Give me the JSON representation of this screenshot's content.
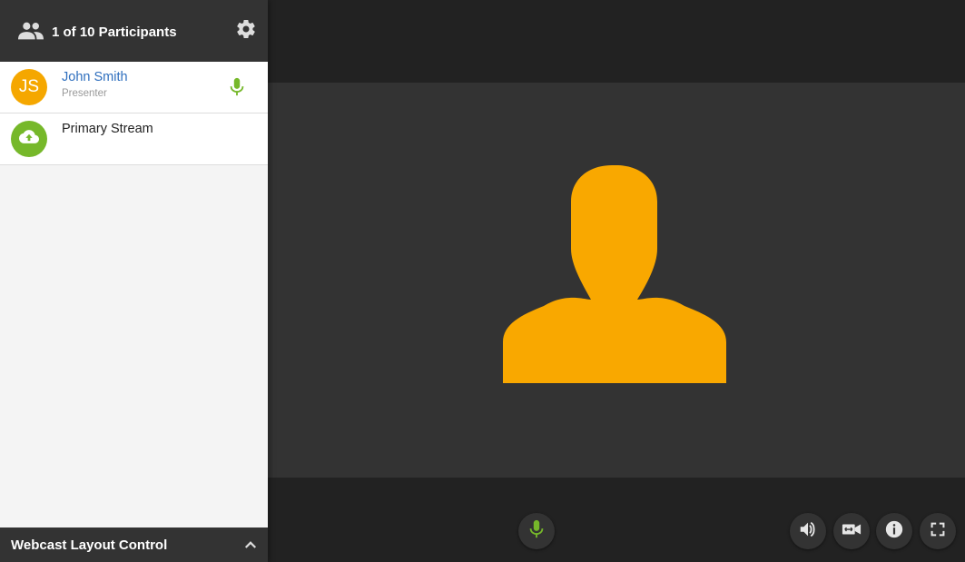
{
  "sidebar": {
    "header": {
      "icon": "people-icon",
      "title": "1 of 10 Participants",
      "settings_icon": "gear-icon"
    },
    "participants": [
      {
        "initials": "JS",
        "name": "John Smith",
        "role": "Presenter",
        "avatar_color": "#f5a700",
        "mic_icon": "microphone-icon",
        "mic_color": "#76b82a"
      },
      {
        "icon": "cloud-upload-icon",
        "name": "Primary Stream",
        "avatar_color": "#76b82a"
      }
    ],
    "footer": {
      "label": "Webcast Layout Control",
      "icon": "chevron-up-icon"
    }
  },
  "main": {
    "placeholder_icon": "person-silhouette-icon",
    "placeholder_color": "#f9a800",
    "controls": {
      "mic": {
        "icon": "microphone-icon",
        "color": "#76b82a"
      },
      "volume": {
        "icon": "volume-icon"
      },
      "camera": {
        "icon": "video-camera-icon"
      },
      "info": {
        "icon": "info-icon"
      },
      "fullscreen": {
        "icon": "fullscreen-icon"
      }
    }
  }
}
